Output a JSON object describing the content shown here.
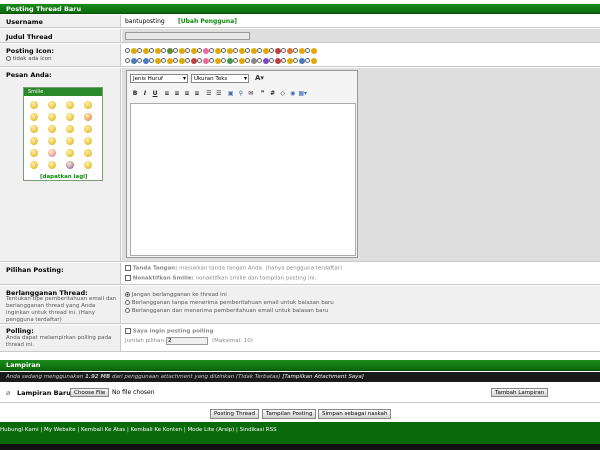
{
  "header": {
    "title": "Posting Thread Baru"
  },
  "username": {
    "label": "Username",
    "value": "bantuposting",
    "change_link": "[Ubah Pengguna]"
  },
  "title_field": {
    "label": "Judul Thread",
    "value": ""
  },
  "post_icon": {
    "label": "Posting Icon:",
    "none_label": "tidak ada icon",
    "icons": [
      "smile",
      "lol",
      "grin",
      "note",
      "cool",
      "surprise",
      "heart",
      "frown",
      "wink",
      "star",
      "sun",
      "confused",
      "mad",
      "rainbow",
      "redface",
      "eek",
      "thumbs",
      "question",
      "ok",
      "idea",
      "sad",
      "angry",
      "blush",
      "roll",
      "cross",
      "sun2",
      "pin",
      "flower",
      "exclaim",
      "cheese",
      "arrow",
      "tongue"
    ]
  },
  "message": {
    "label": "Pesan Anda:",
    "smilies_title": "Smilie",
    "get_more": "[dapatkan lagi]",
    "font_select": "Jenis Huruf",
    "size_select": "Ukuran Teks"
  },
  "options": {
    "label": "Pilihan Posting:",
    "signature_label": "Tanda Tangan:",
    "signature_desc": "masukkan tanda tangan Anda. (hanya pengguna terdaftar)",
    "disable_smilies_label": "Nonaktifkan Smilie:",
    "disable_smilies_desc": "nonaktifkan smilie dan tampilan posting ini."
  },
  "subscribe": {
    "label": "Berlangganan Thread:",
    "desc": "Tentukan tipe pemberitahuan email dan berlangganan thread yang Anda inginkan untuk thread ini. (Hany pengguna terdaftar)",
    "opt1": "Jangan berlangganan ke thread ini",
    "opt2": "Berlangganan tanpa menerima pemberitahuan email untuk balasan baru",
    "opt3": "Berlangganan dan menerima pemberitahuan email untuk balasan baru"
  },
  "polling": {
    "label": "Polling:",
    "desc": "Anda dapat melampirkan polling pada thread ini.",
    "checkbox_label": "Saya ingin posting polling",
    "count_label": "Jumlah pilihan:",
    "count_value": "2",
    "max_text": "(Maksimal: 10)"
  },
  "attachments": {
    "title": "Lampiran",
    "info_prefix": "Anda sedang menggunakan",
    "info_size": "1.92 MB",
    "info_middle": "dari penggunaan attachment yang diizinkan (Tidak Terbatas)",
    "info_link": "[Tampilkan Attachment Saya]",
    "upload_label": "Lampiran Baru:",
    "choose_file": "Choose File",
    "no_file": "No file chosen",
    "add_button": "Tambah Lampiran"
  },
  "actions": {
    "post": "Posting Thread",
    "preview": "Tampilan Posting",
    "save": "Simpan sebagai naskah"
  },
  "footer": {
    "links": [
      "Hubungi Kami",
      "My Website",
      "Kembali Ke Atas",
      "Kembali Ke Konten",
      "Mode Lite (Arsip)",
      "Sindikasi RSS"
    ]
  }
}
